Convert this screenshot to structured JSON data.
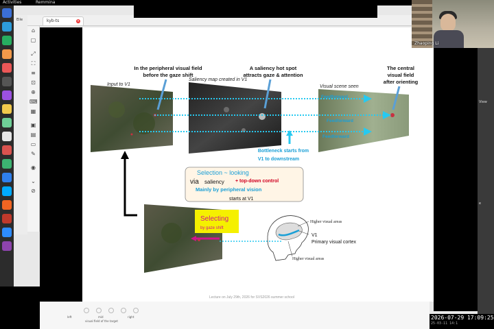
{
  "system": {
    "activities": "Activities",
    "app_name": "Remmina"
  },
  "tab": {
    "label": "kyb-ts"
  },
  "leftpanel": {
    "label": "Eile"
  },
  "slide": {
    "label_peripheral": [
      "In the peripheral visual field",
      "before the gaze shift"
    ],
    "label_hotspot": [
      "A saliency hot spot",
      "attracts gaze & attention"
    ],
    "label_central": [
      "The central",
      "visual field",
      "after orienting"
    ],
    "label_input": "Input to V1",
    "label_saliency_map": "Saliency map created in V1",
    "label_visual_scene": "Visual scene seen",
    "feedforward": "Feedforward",
    "bottleneck": [
      "Bottleneck starts from",
      "V1 to downstream"
    ],
    "selection_title": "Selection ~ looking",
    "via": "via",
    "saliency": "saliency",
    "topdown": "+ top-down control",
    "mainly": "Mainly by peripheral vision",
    "starts": "starts at V1",
    "selecting": "Selecting",
    "by_gaze": "by gaze shift",
    "higher_top": "Higher visual areas",
    "v1": "V1",
    "primary": "Primary visual cortex",
    "higher_bottom": "Higher visual areas",
    "footer": "Lecture on July 29th, 2026 for SVS2026 summer school"
  },
  "camera": {
    "participant": "Zhaoping Li"
  },
  "right": {
    "t1": "View",
    "t2": "e"
  },
  "bottom": {
    "left": "left",
    "mid": "mid",
    "right": "right",
    "caption": "visual field of the target"
  },
  "clock": {
    "datetime": "2026-07-29  17:09:25",
    "sub": "25-03-11 14:1"
  },
  "colors": {
    "cyan": "#1a9fd6",
    "dotted": "#27c9f0",
    "magenta": "#d0148a",
    "red": "#d00020",
    "yellow": "#f5f000",
    "box_fill": "#fff5e6"
  }
}
